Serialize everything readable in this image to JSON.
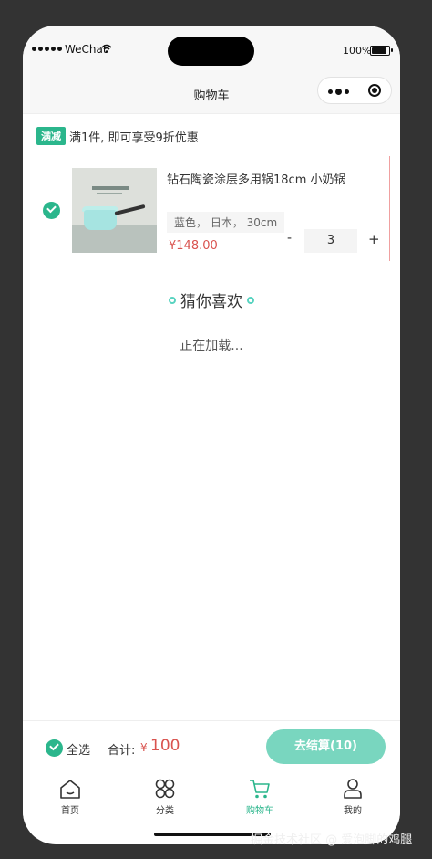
{
  "status": {
    "carrier": "WeChat",
    "battery": "100%"
  },
  "navbar": {
    "title": "购物车"
  },
  "promo": {
    "badge": "满减",
    "text": "满1件, 即可享受9折优惠"
  },
  "cart_item": {
    "selected": true,
    "title": "钻石陶瓷涂层多用锅18cm 小奶锅",
    "spec": "蓝色， 日本， 30cm",
    "price": "¥148.00",
    "quantity": "3",
    "minus": "-",
    "plus": "+"
  },
  "guess": {
    "title": "猜你喜欢",
    "loading": "正在加载..."
  },
  "bottom_bar": {
    "select_all": "全选",
    "total_label": "合计:",
    "currency": "¥",
    "total_value": "100",
    "checkout": "去结算(10)"
  },
  "tabbar": {
    "items": [
      {
        "label": "首页",
        "icon": "home-icon",
        "active": false
      },
      {
        "label": "分类",
        "icon": "category-icon",
        "active": false
      },
      {
        "label": "购物车",
        "icon": "cart-icon",
        "active": true
      },
      {
        "label": "我的",
        "icon": "user-icon",
        "active": false
      }
    ]
  },
  "colors": {
    "accent": "#2bb68c",
    "price": "#d9534f",
    "checkout_button": "#79d6bf"
  },
  "watermark": "掘金技术社区 @ 爱泡脚的鸡腿"
}
